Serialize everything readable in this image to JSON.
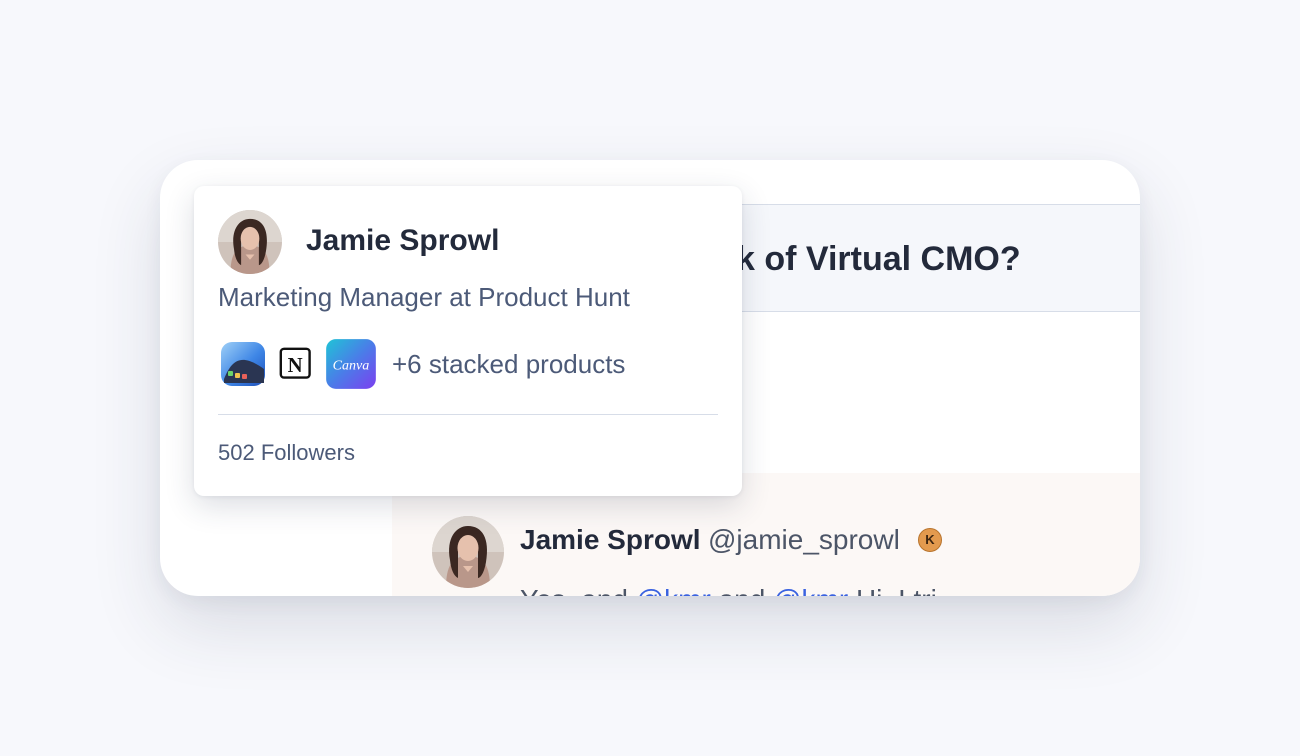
{
  "question": {
    "title": "k of Virtual CMO?"
  },
  "comment": {
    "author": "Jamie Sprowl",
    "handle": "@jamie_sprowl",
    "badge": "K",
    "body_start": "Yes, and ",
    "mention_1": "@kmr",
    "body_mid": " and ",
    "mention_2": "@kmr",
    "body_end": " Hi. I tri"
  },
  "profile_card": {
    "name": "Jamie Sprowl",
    "headline": "Marketing Manager at Product Hunt",
    "stack": {
      "icons": [
        "mac-app-icon",
        "notion-icon",
        "canva-icon"
      ],
      "notion_letter": "N",
      "canva_wordmark": "Canva",
      "more_label": "+6 stacked products"
    },
    "followers": "502 Followers"
  },
  "colors": {
    "page_bg": "#f7f8fc",
    "title_text": "#232a3b",
    "muted_text": "#4c5a78",
    "mention": "#3a62e0",
    "comment_bg": "#fcf8f6",
    "karma": "#e39a4e"
  }
}
